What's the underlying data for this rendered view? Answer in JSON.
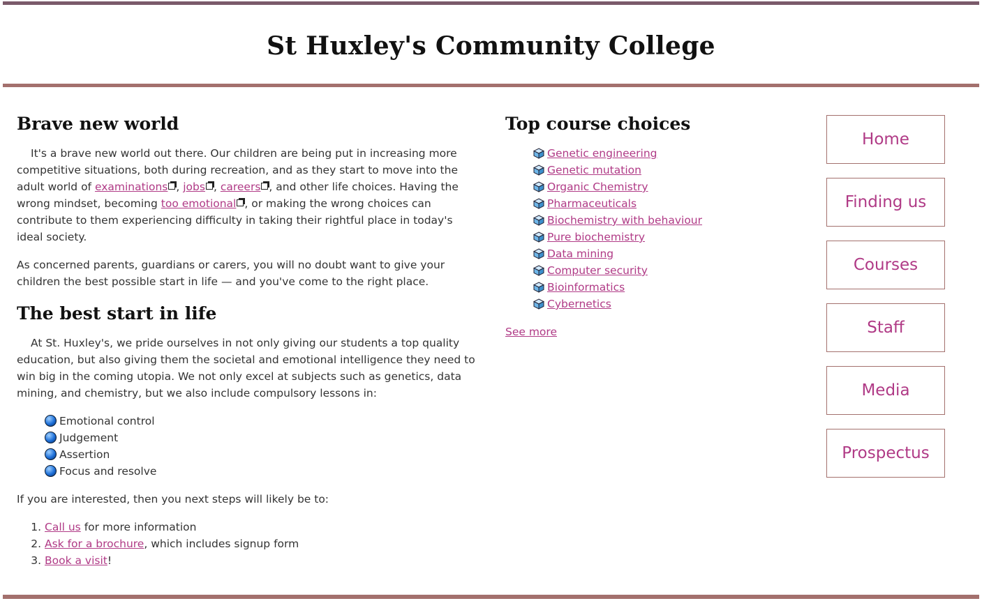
{
  "header": {
    "title": "St Huxley's Community College"
  },
  "colors": {
    "accent": "#b03a86",
    "rule": "#a3706d",
    "top_rule": "#7a5a6a"
  },
  "main": {
    "section1": {
      "heading": "Brave new world",
      "p1": {
        "t1": "It's a brave new world out there. Our children are being put in increasing more competitive situations, both during recreation, and as they start to move into the adult world of ",
        "link1": "examinations",
        "t2": ", ",
        "link2": "jobs",
        "t3": ", ",
        "link3": "careers",
        "t4": ", and other life choices. Having the wrong mindset, becoming ",
        "link4": "too emotional",
        "t5": ", or making the wrong choices can contribute to them experiencing difficulty in taking their rightful place in today's ideal society."
      },
      "p2": "As concerned parents, guardians or carers, you will no doubt want to give your children the best possible start in life — and you've come to the right place."
    },
    "section2": {
      "heading": "The best start in life",
      "p1": "At St. Huxley's, we pride ourselves in not only giving our students a top quality education, but also giving them the societal and emotional intelligence they need to win big in the coming utopia. We not only excel at subjects such as genetics, data mining, and chemistry, but we also include compulsory lessons in:",
      "lessons": [
        "Emotional control",
        "Judgement",
        "Assertion",
        "Focus and resolve"
      ],
      "p2": "If you are interested, then you next steps will likely be to:",
      "steps": [
        {
          "link": "Call us",
          "rest": " for more information"
        },
        {
          "link": "Ask for a brochure",
          "rest": ", which includes signup form"
        },
        {
          "link": "Book a visit",
          "rest": "!"
        }
      ]
    }
  },
  "courses": {
    "heading": "Top course choices",
    "items": [
      "Genetic engineering",
      "Genetic mutation",
      "Organic Chemistry",
      "Pharmaceuticals",
      "Biochemistry with behaviour",
      "Pure biochemistry",
      "Data mining",
      "Computer security",
      "Bioinformatics",
      "Cybernetics"
    ],
    "see_more": "See more"
  },
  "nav": {
    "items": [
      "Home",
      "Finding us",
      "Courses",
      "Staff",
      "Media",
      "Prospectus"
    ]
  },
  "icons": {
    "external_link": "external-link-icon",
    "bullet": "blue-bullet-icon",
    "course": "cube-icon"
  }
}
